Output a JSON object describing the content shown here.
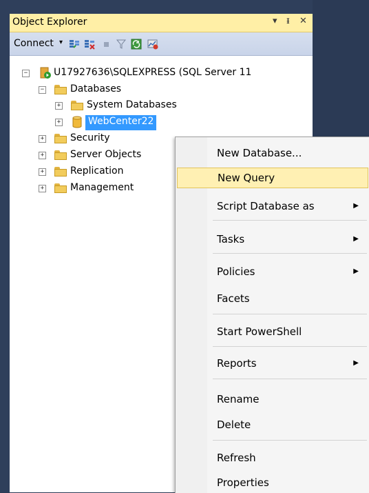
{
  "panel": {
    "title": "Object Explorer",
    "title_buttons": [
      "▾",
      "ᵻ",
      "✕"
    ]
  },
  "toolbar": {
    "connect_label": "Connect",
    "connect_caret": "▾",
    "icons": [
      "connect-object-explorer-icon",
      "disconnect-icon",
      "stop-icon",
      "filter-icon",
      "refresh-icon",
      "activity-monitor-icon"
    ]
  },
  "tree": {
    "server": "U17927636\\SQLEXPRESS (SQL Server 11",
    "databases": "Databases",
    "system_databases": "System Databases",
    "selected_db": "WebCenter22",
    "security": "Security",
    "server_objects": "Server Objects",
    "replication": "Replication",
    "management": "Management"
  },
  "context_menu": {
    "items": [
      {
        "label": "New Database...",
        "submenu": false
      },
      {
        "label": "New Query",
        "submenu": false,
        "highlighted": true
      },
      {
        "label": "Script Database as",
        "submenu": true
      },
      {
        "label": "Tasks",
        "submenu": true
      },
      {
        "label": "Policies",
        "submenu": true
      },
      {
        "label": "Facets",
        "submenu": false
      },
      {
        "label": "Start PowerShell",
        "submenu": false
      },
      {
        "label": "Reports",
        "submenu": true
      },
      {
        "label": "Rename",
        "submenu": false
      },
      {
        "label": "Delete",
        "submenu": false
      },
      {
        "label": "Refresh",
        "submenu": false
      },
      {
        "label": "Properties",
        "submenu": false
      }
    ],
    "arrow_glyph": "▶"
  },
  "colors": {
    "selection": "#3399ff",
    "menu_highlight": "#fff0b3",
    "title_bar": "#ffefa6"
  }
}
